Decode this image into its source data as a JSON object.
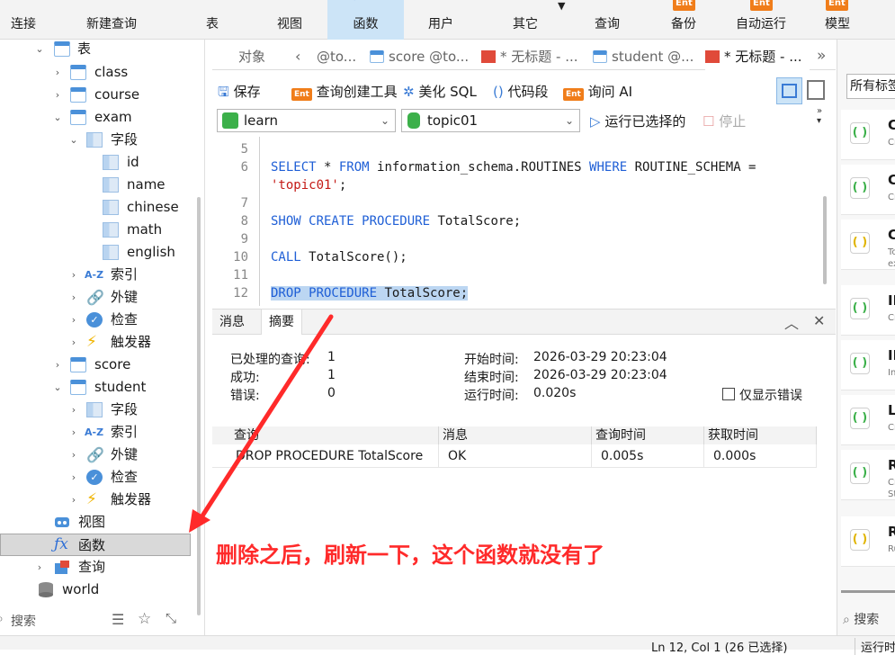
{
  "toolbar": {
    "connect": "连接",
    "new_query": "新建查询",
    "table": "表",
    "view": "视图",
    "function": "函数",
    "user": "用户",
    "other": "其它",
    "query": "查询",
    "backup": "备份",
    "auto_run": "自动运行",
    "model": "模型",
    "ent_badge": "Ent"
  },
  "tree": {
    "tables": "表",
    "class": "class",
    "course": "course",
    "exam": "exam",
    "fields": "字段",
    "f_id": "id",
    "f_name": "name",
    "f_chinese": "chinese",
    "f_math": "math",
    "f_english": "english",
    "indexes": "索引",
    "foreign_keys": "外键",
    "checks": "检查",
    "triggers": "触发器",
    "score": "score",
    "student": "student",
    "s_fields": "字段",
    "s_indexes": "索引",
    "s_foreign_keys": "外键",
    "s_checks": "检查",
    "s_triggers": "触发器",
    "views": "视图",
    "functions": "函数",
    "queries": "查询",
    "world": "world",
    "az_glyph": "A-Z",
    "search_placeholder": "搜索"
  },
  "tabs": {
    "objects": "对象",
    "t1": "@to...",
    "t2": "score @to...",
    "t3": "* 无标题 - ...",
    "t4": "student @...",
    "t5": "* 无标题 - ..."
  },
  "editor_toolbar": {
    "save": "保存",
    "query_builder": "查询创建工具",
    "beautify": "美化 SQL",
    "snippet": "代码段",
    "ask_ai": "询问 AI",
    "connection": "learn",
    "database": "topic01",
    "run_selected": "运行已选择的",
    "stop": "停止"
  },
  "editor": {
    "line_numbers": [
      "5",
      "6",
      "7",
      "8",
      "9",
      "10",
      "11",
      "12"
    ],
    "l6_kw1": "SELECT",
    "l6_mid": " * ",
    "l6_kw2": "FROM",
    "l6_mid2": " information_schema.ROUTINES ",
    "l6_kw3": "WHERE",
    "l6_mid3": " ROUTINE_SCHEMA =",
    "l6b_str": "'topic01'",
    "l6b_end": ";",
    "l8_kw": "SHOW CREATE PROCEDURE",
    "l8_rest": " TotalScore;",
    "l10_kw": "CALL",
    "l10_rest": " TotalScore();",
    "l12_kw": "DROP PROCEDURE",
    "l12_rest": " TotalScore;"
  },
  "result": {
    "tab_messages": "消息",
    "tab_summary": "摘要",
    "processed_label": "已处理的查询:",
    "processed_value": "1",
    "success_label": "成功:",
    "success_value": "1",
    "error_label": "错误:",
    "error_value": "0",
    "start_label": "开始时间:",
    "start_value": "2026-03-29 20:23:04",
    "end_label": "结束时间:",
    "end_value": "2026-03-29 20:23:04",
    "elapsed_label": "运行时间:",
    "elapsed_value": "0.020s",
    "only_errors": "仅显示错误",
    "columns": [
      "查询",
      "消息",
      "查询时间",
      "获取时间"
    ],
    "row": [
      "DROP PROCEDURE TotalScore",
      "OK",
      "0.005s",
      "0.000s"
    ]
  },
  "right_panel": {
    "filter": "所有标签",
    "cards": [
      {
        "name": "C",
        "sub": "Cr"
      },
      {
        "name": "C",
        "sub": "Cr"
      },
      {
        "name": "C",
        "sub": "To\nex"
      },
      {
        "name": "IF",
        "sub": "Cr"
      },
      {
        "name": "IN",
        "sub": "In"
      },
      {
        "name": "L",
        "sub": "Cr"
      },
      {
        "name": "R",
        "sub": "Cr\nSt\nse"
      },
      {
        "name": "R",
        "sub": "Ru"
      }
    ],
    "search": "搜索"
  },
  "statusbar": {
    "position": "Ln 12, Col 1 (26 已选择)",
    "run": "运行时间"
  },
  "annotation": "删除之后，刷新一下，这个函数就没有了",
  "colors": {
    "accent": "#cce4f7",
    "annotation_red": "#ff2a2a",
    "keyword_blue": "#1f5fd6",
    "string_red": "#c41a16"
  }
}
